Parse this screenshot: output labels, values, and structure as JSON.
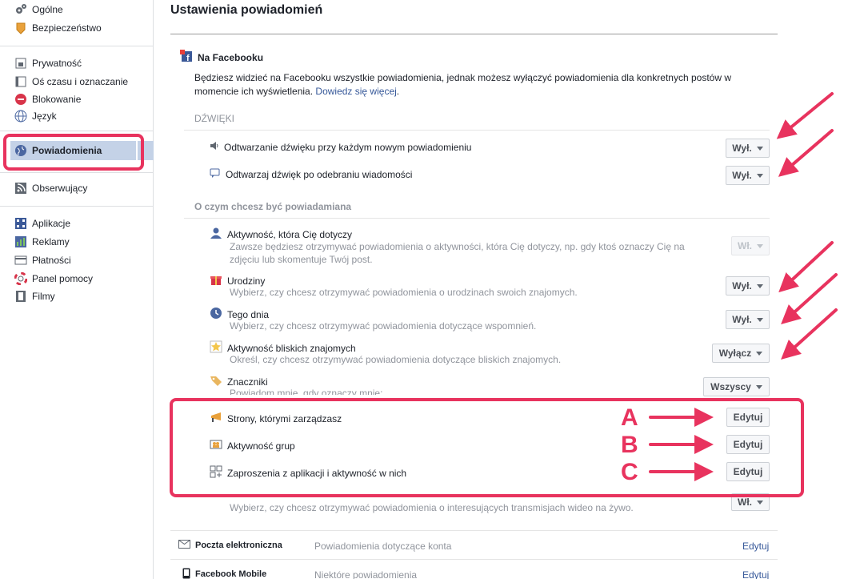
{
  "sidebar": {
    "items": [
      {
        "label": "Ogólne",
        "icon": "gears-icon"
      },
      {
        "label": "Bezpieczeństwo",
        "icon": "badge-icon"
      },
      {
        "label": "Prywatność",
        "icon": "lock-icon"
      },
      {
        "label": "Oś czasu i oznaczanie",
        "icon": "timeline-icon"
      },
      {
        "label": "Blokowanie",
        "icon": "block-icon"
      },
      {
        "label": "Język",
        "icon": "globe-icon"
      },
      {
        "label": "Powiadomienia",
        "icon": "globe-icon"
      },
      {
        "label": "Obserwujący",
        "icon": "rss-icon"
      },
      {
        "label": "Aplikacje",
        "icon": "apps-icon"
      },
      {
        "label": "Reklamy",
        "icon": "ads-icon"
      },
      {
        "label": "Płatności",
        "icon": "card-icon"
      },
      {
        "label": "Panel pomocy",
        "icon": "lifebuoy-icon"
      },
      {
        "label": "Filmy",
        "icon": "film-icon"
      }
    ]
  },
  "main": {
    "title": "Ustawienia powiadomień",
    "section": "Na Facebooku",
    "intro": "Będziesz widzieć na Facebooku wszystkie powiadomienia, jednak możesz wyłączyć powiadomienia dla konkretnych postów w momencie ich wyświetlenia.",
    "intro_link": "Dowiedz się więcej",
    "sounds_header": "DŹWIĘKI",
    "sounds": [
      {
        "label": "Odtwarzanie dźwięku przy każdym nowym powiadomieniu",
        "button": "Wył."
      },
      {
        "label": "Odtwarzaj dźwięk po odebraniu wiadomości",
        "button": "Wył."
      }
    ],
    "what_header": "O czym chcesz być powiadamiana",
    "rows": [
      {
        "label": "Aktywność, która Cię dotyczy",
        "desc": "Zawsze będziesz otrzymywać powiadomienia o aktywności, która Cię dotyczy, np. gdy ktoś oznaczy Cię na zdjęciu lub skomentuje Twój post.",
        "button": "Wł."
      },
      {
        "label": "Urodziny",
        "desc": "Wybierz, czy chcesz otrzymywać powiadomienia o urodzinach swoich znajomych.",
        "button": "Wył."
      },
      {
        "label": "Tego dnia",
        "desc": "Wybierz, czy chcesz otrzymywać powiadomienia dotyczące wspomnień.",
        "button": "Wył."
      },
      {
        "label": "Aktywność bliskich znajomych",
        "desc": "Określ, czy chcesz otrzymywać powiadomienia dotyczące bliskich znajomych.",
        "button": "Wyłącz"
      },
      {
        "label": "Znaczniki",
        "desc": "Powiadom mnie, gdy oznaczy mnie:",
        "button": "Wszyscy"
      }
    ],
    "edit_rows": [
      {
        "label": "Strony, którymi zarządzasz",
        "button": "Edytuj",
        "marker": "A"
      },
      {
        "label": "Aktywność grup",
        "button": "Edytuj",
        "marker": "B"
      },
      {
        "label": "Zaproszenia z aplikacji i aktywność w nich",
        "button": "Edytuj",
        "marker": "C"
      }
    ],
    "live_desc": "Wybierz, czy chcesz otrzymywać powiadomienia o interesujących transmisjach wideo na żywo.",
    "live_button": "Wł.",
    "bottom": [
      {
        "label": "Poczta elektroniczna",
        "desc": "Powiadomienia dotyczące konta",
        "edit": "Edytuj"
      },
      {
        "label": "Facebook Mobile",
        "desc": "Niektóre powiadomienia",
        "edit": "Edytuj"
      }
    ]
  },
  "colors": {
    "accent": "#e8335e",
    "link": "#365899",
    "active": "#c4d2e7"
  }
}
